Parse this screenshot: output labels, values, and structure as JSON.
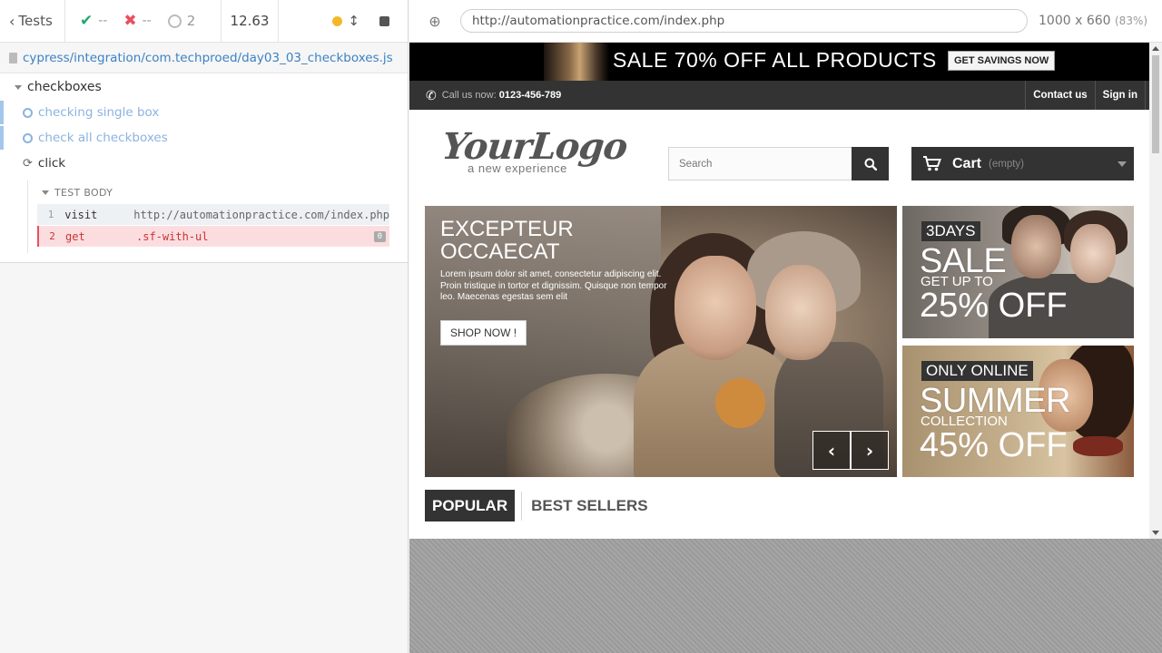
{
  "reporter": {
    "tests_label": "Tests",
    "passed": "--",
    "failed": "--",
    "pending": "2",
    "duration": "12.63",
    "spec_path": "cypress/integration/com.techproed/day03_03_checkboxes.js",
    "suite": "checkboxes",
    "tests": [
      {
        "title": "checking single box",
        "state": "pending"
      },
      {
        "title": "check all checkboxes",
        "state": "pending"
      },
      {
        "title": "click",
        "state": "running"
      }
    ],
    "section_label": "TEST BODY",
    "commands": [
      {
        "num": "1",
        "name": "visit",
        "message": "http://automationpractice.com/index.php"
      },
      {
        "num": "2",
        "name": "get",
        "message": ".sf-with-ul",
        "count": "0"
      }
    ]
  },
  "runner": {
    "url": "http://automationpractice.com/index.php",
    "viewport": "1000 x 660",
    "scale": "(83%)"
  },
  "site": {
    "promo_text": "SALE 70% OFF ALL PRODUCTS",
    "promo_button": "GET SAVINGS NOW",
    "call_label": "Call us now:",
    "phone": "0123-456-789",
    "nav": [
      "Contact us",
      "Sign in"
    ],
    "logo": "YourLogo",
    "logo_tagline": "a new experience",
    "search_placeholder": "Search",
    "cart_label": "Cart",
    "cart_status": "(empty)",
    "slider": {
      "title_line1": "EXCEPTEUR",
      "title_line2": "OCCAECAT",
      "text": "Lorem ipsum dolor sit amet, consectetur adipiscing elit. Proin tristique in tortor et dignissim. Quisque non tempor leo. Maecenas egestas sem elit",
      "button": "SHOP NOW !"
    },
    "banner1": {
      "tag": "3DAYS",
      "big": "SALE",
      "small": "GET UP TO",
      "pct": "25% OFF"
    },
    "banner2": {
      "tag": "ONLY ONLINE",
      "big": "SUMMER",
      "small": "COLLECTION",
      "pct": "45% OFF"
    },
    "tabs": [
      "POPULAR",
      "BEST SELLERS"
    ]
  },
  "colors": {
    "pass": "#1fa971",
    "fail": "#e94f5d",
    "running_dot": "#f5b72a",
    "link": "#3b82c4",
    "site_dark": "#333333"
  }
}
